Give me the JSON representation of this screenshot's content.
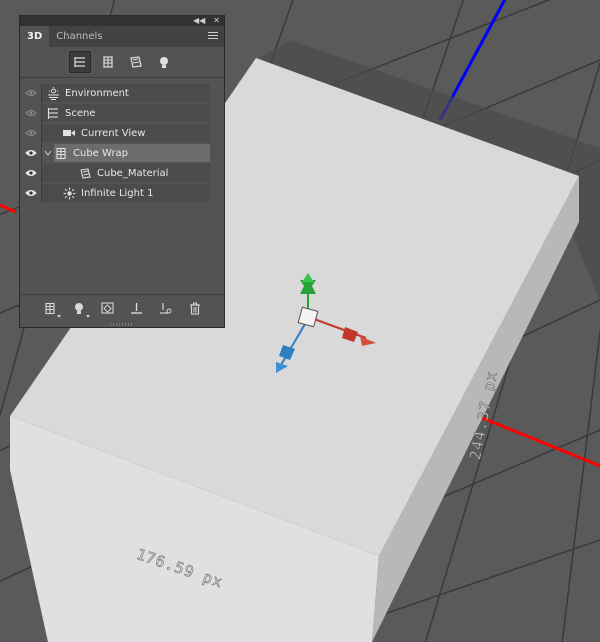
{
  "panel": {
    "tabs": [
      {
        "label": "3D",
        "active": true
      },
      {
        "label": "Channels",
        "active": false
      }
    ],
    "toolbar_icons": [
      "scene-filter-icon",
      "mesh-filter-icon",
      "material-filter-icon",
      "light-filter-icon"
    ],
    "layers": [
      {
        "label": "Environment",
        "icon": "environment-icon",
        "visible": false,
        "indent": 0,
        "selected": false
      },
      {
        "label": "Scene",
        "icon": "scene-icon",
        "visible": false,
        "indent": 0,
        "selected": false
      },
      {
        "label": "Current View",
        "icon": "camera-icon",
        "visible": false,
        "indent": 1,
        "selected": false
      },
      {
        "label": "Cube Wrap",
        "icon": "mesh-icon",
        "visible": true,
        "indent": 1,
        "selected": true,
        "expanded": true
      },
      {
        "label": "Cube_Material",
        "icon": "material-icon",
        "visible": true,
        "indent": 2,
        "selected": false
      },
      {
        "label": "Infinite Light 1",
        "icon": "light-icon",
        "visible": true,
        "indent": 1,
        "selected": false
      }
    ],
    "bottom_icons": [
      "new-mesh-icon",
      "new-light-icon",
      "render-icon",
      "ground-icon",
      "drop-to-ground-icon",
      "delete-icon"
    ]
  },
  "viewport": {
    "width_label": "176.59 px",
    "depth_label": "244.37 px",
    "colors": {
      "ground": "#5a5a5a",
      "grid": "#3a3a3a",
      "x_axis": "#ff0000",
      "z_axis": "#0000ff",
      "cube_top": "#d9d9d9",
      "cube_front": "#e0e0e0",
      "cube_side": "#b8b8b8",
      "gizmo_x": "#c0392b",
      "gizmo_y": "#27a33a",
      "gizmo_z": "#2f7fc1"
    }
  }
}
